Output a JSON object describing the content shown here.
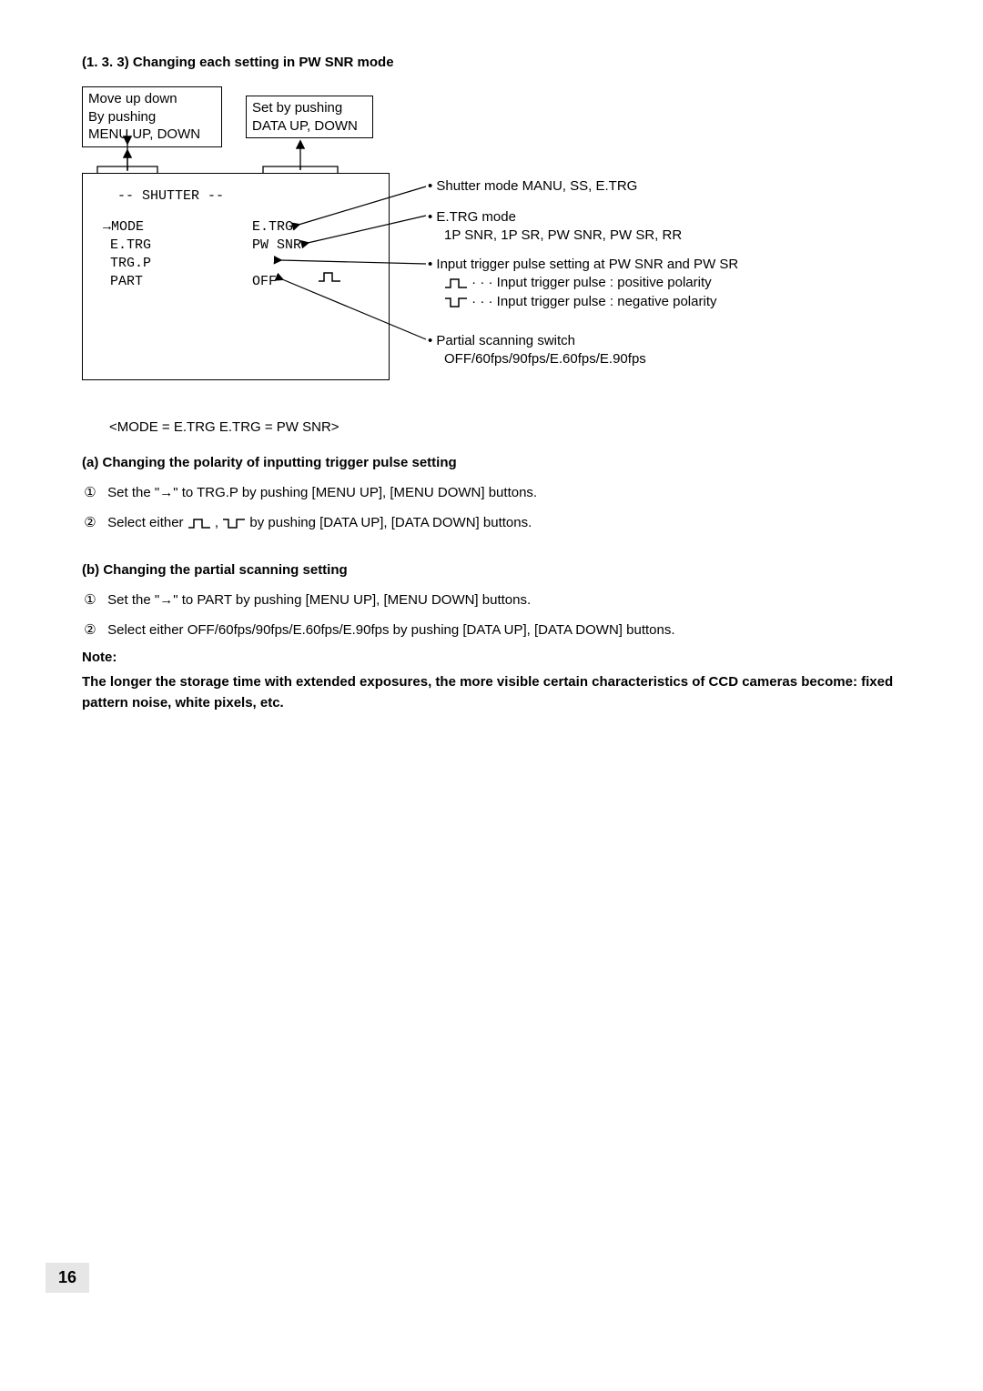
{
  "title": "(1. 3. 3)   Changing each setting in PW SNR mode",
  "diagram": {
    "box_left_line1": "Move up down",
    "box_left_line2": "By pushing",
    "box_left_line3": "MENU UP, DOWN",
    "box_right_line1": "Set by pushing",
    "box_right_line2": "DATA UP, DOWN",
    "menu_header": "-- SHUTTER --",
    "menu_rows": [
      {
        "left": "→MODE",
        "right": "E.TRG"
      },
      {
        "left": " E.TRG",
        "right": "PW SNR"
      },
      {
        "left": " TRG.P",
        "right": "PULSE_POS"
      },
      {
        "left": " PART",
        "right": "OFF"
      }
    ],
    "annot1_a": "• Shutter mode   MANU, SS, E.TRG",
    "annot2_a": "• E.TRG mode",
    "annot2_b": "1P SNR, 1P SR, PW SNR, PW SR, RR",
    "annot3_a": "• Input trigger pulse setting at PW SNR and PW SR",
    "annot3_b": "Input trigger pulse : positive polarity",
    "annot3_c": "Input trigger pulse : negative polarity",
    "annot4_a": "• Partial scanning switch",
    "annot4_b": "OFF/60fps/90fps/E.60fps/E.90fps",
    "dots": "· · ·"
  },
  "caption": "<MODE = E.TRG   E.TRG = PW SNR>",
  "section_a_title": "(a)  Changing the polarity of inputting trigger pulse setting",
  "step_a1": "Set the \"→\" to TRG.P by pushing [MENU UP], [MENU DOWN] buttons.",
  "step_a2_pre": "Select either",
  "step_a2_mid": " , ",
  "step_a2_post": " by pushing [DATA UP], [DATA DOWN] buttons.",
  "section_b_title": "(b) Changing the partial scanning setting",
  "step_b1": "Set the \"→\" to PART by pushing [MENU UP], [MENU DOWN] buttons.",
  "step_b2": "Select either OFF/60fps/90fps/E.60fps/E.90fps by pushing [DATA UP], [DATA DOWN] buttons.",
  "note_label": "Note:",
  "note_body": "The longer the storage time with extended exposures, the more visible certain characteristics of CCD cameras become: fixed pattern noise, white pixels, etc.",
  "circled1": "①",
  "circled2": "②",
  "page_number": "16"
}
